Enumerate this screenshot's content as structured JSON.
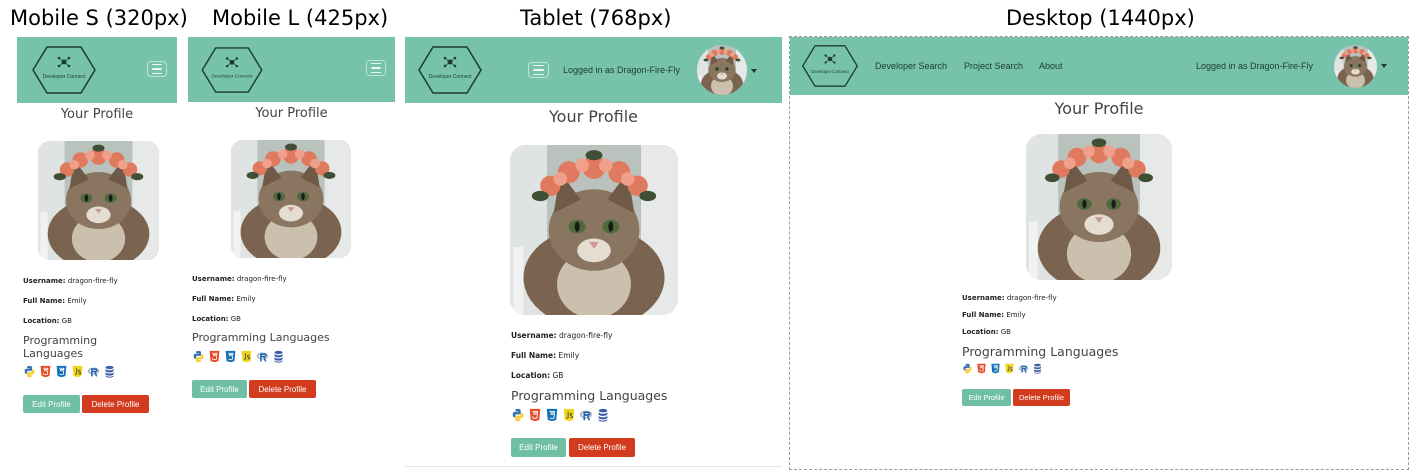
{
  "captions": [
    "Mobile S (320px)",
    "Mobile L (425px)",
    "Tablet (768px)",
    "Desktop (1440px)"
  ],
  "colors": {
    "nav": "#77c2ab",
    "edit": "#6fbfa6",
    "delete": "#d23b1d"
  },
  "logo_text": "Developer Connect",
  "nav": {
    "links": [
      "Developer Search",
      "Project Search",
      "About"
    ],
    "logged_in": "Logged in as Dragon-Fire-Fly"
  },
  "profile": {
    "title": "Your Profile",
    "username_label": "Username:",
    "username": "dragon-fire-fly",
    "fullname_label": "Full Name:",
    "fullname": "Emily",
    "location_label": "Location:",
    "location": "GB",
    "languages_title": "Programming Languages",
    "languages": [
      "python-icon",
      "html5-icon",
      "css3-icon",
      "javascript-icon",
      "r-icon",
      "database-icon"
    ]
  },
  "buttons": {
    "edit": "Edit Profile",
    "delete": "Delete Profile"
  }
}
